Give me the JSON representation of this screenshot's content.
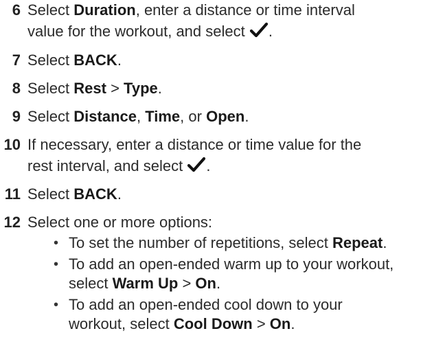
{
  "steps": [
    {
      "num": "6",
      "p1": "Select ",
      "b1": "Duration",
      "p2": ", enter a distance or time interval",
      "line2": "value for the workout, and select ",
      "end": "."
    },
    {
      "num": "7",
      "p1": "Select ",
      "b1": "BACK",
      "end": "."
    },
    {
      "num": "8",
      "p1": "Select ",
      "b1": "Rest",
      "sep": " > ",
      "b2": "Type",
      "end": "."
    },
    {
      "num": "9",
      "p1": "Select ",
      "b1": "Distance",
      "c1": ", ",
      "b2": "Time",
      "c2": ", or ",
      "b3": "Open",
      "end": "."
    },
    {
      "num": "10",
      "line1": "If necessary, enter a distance or time value for the",
      "line2": "rest interval, and select ",
      "end": "."
    },
    {
      "num": "11",
      "p1": "Select ",
      "b1": "BACK",
      "end": "."
    },
    {
      "num": "12",
      "line1": "Select one or more options:"
    }
  ],
  "bullets": [
    {
      "p1": "To set the number of repetitions, select ",
      "b1": "Repeat",
      "end": "."
    },
    {
      "line1": "To add an open-ended warm up to your workout,",
      "p1": "select ",
      "b1": "Warm Up",
      "sep": " > ",
      "b2": "On",
      "end": "."
    },
    {
      "line1": "To add an open-ended cool down to your",
      "p1": "workout, select ",
      "b1": "Cool Down",
      "sep": " > ",
      "b2": "On",
      "end": "."
    }
  ],
  "bullet_glyph": "•",
  "check_icon": "checkmark-icon"
}
